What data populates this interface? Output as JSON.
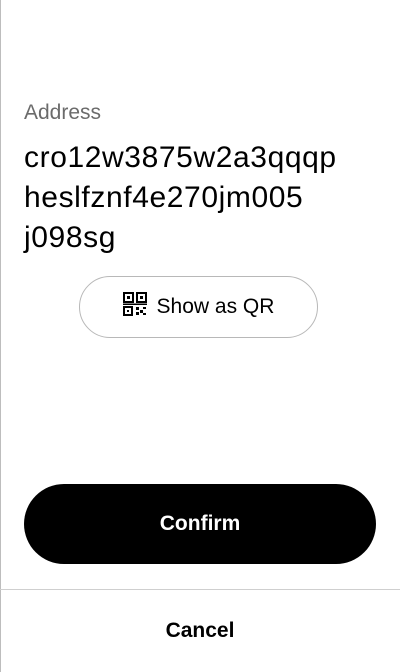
{
  "address": {
    "label": "Address",
    "value": "cro12w3875w2a3qqqpheslfznf4e270jm005j098sg"
  },
  "qr_button": {
    "label": "Show as QR",
    "icon": "qr-code-icon"
  },
  "confirm_button": {
    "label": "Confirm"
  },
  "cancel_button": {
    "label": "Cancel"
  }
}
